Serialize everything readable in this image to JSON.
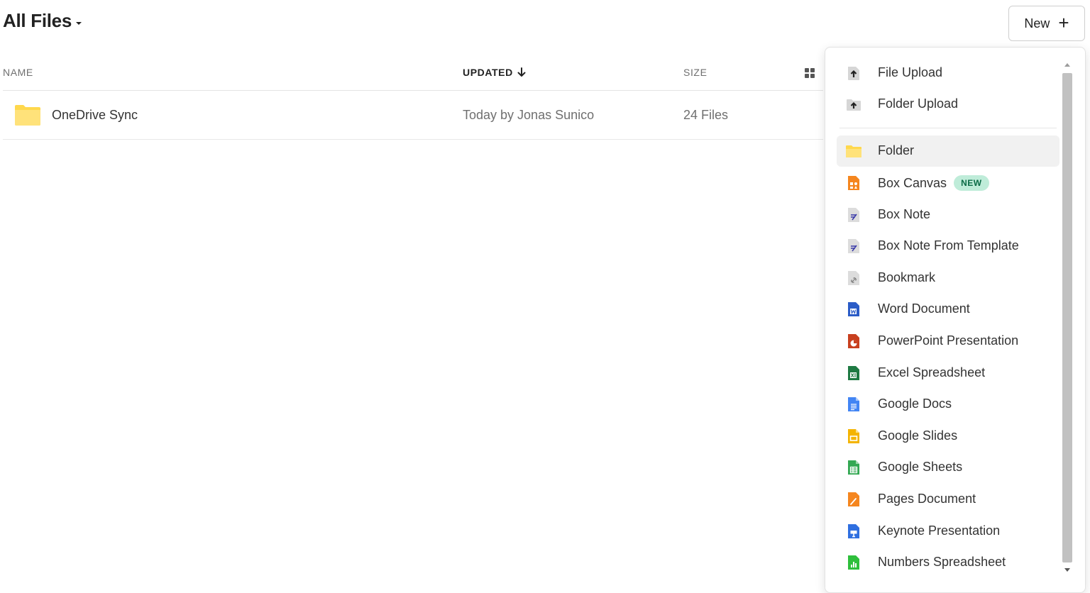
{
  "header": {
    "title": "All Files",
    "new_button_label": "New",
    "new_button_icon": "plus-icon"
  },
  "table": {
    "columns": {
      "name": "NAME",
      "updated": "UPDATED",
      "size": "SIZE"
    },
    "sort_icon": "arrow-down-icon",
    "view_icon": "grid-view-icon",
    "rows": [
      {
        "name": "OneDrive Sync",
        "updated": "Today by Jonas Sunico",
        "size": "24 Files",
        "icon": "folder-icon"
      }
    ]
  },
  "menu": {
    "items": [
      {
        "label": "File Upload",
        "icon": "file-upload-icon"
      },
      {
        "label": "Folder Upload",
        "icon": "folder-upload-icon"
      },
      {
        "label": "Folder",
        "icon": "folder-icon"
      },
      {
        "label": "Box Canvas",
        "icon": "box-canvas-icon",
        "badge": "NEW"
      },
      {
        "label": "Box Note",
        "icon": "box-note-icon"
      },
      {
        "label": "Box Note From Template",
        "icon": "box-note-template-icon"
      },
      {
        "label": "Bookmark",
        "icon": "bookmark-icon"
      },
      {
        "label": "Word Document",
        "icon": "word-icon"
      },
      {
        "label": "PowerPoint Presentation",
        "icon": "powerpoint-icon"
      },
      {
        "label": "Excel Spreadsheet",
        "icon": "excel-icon"
      },
      {
        "label": "Google Docs",
        "icon": "google-docs-icon"
      },
      {
        "label": "Google Slides",
        "icon": "google-slides-icon"
      },
      {
        "label": "Google Sheets",
        "icon": "google-sheets-icon"
      },
      {
        "label": "Pages Document",
        "icon": "pages-icon"
      },
      {
        "label": "Keynote Presentation",
        "icon": "keynote-icon"
      },
      {
        "label": "Numbers Spreadsheet",
        "icon": "numbers-icon"
      }
    ]
  },
  "colors": {
    "folder": "#ffd84d",
    "badge_bg": "#bfecd9",
    "badge_text": "#0b6b46",
    "word": "#2b5cc7",
    "powerpoint": "#c8401f",
    "excel": "#1f7a43",
    "google_docs": "#4285f4",
    "google_slides": "#f4b400",
    "google_sheets": "#34a853",
    "pages": "#f5861f",
    "keynote": "#2f6fe0",
    "numbers": "#2fbf3c",
    "box_canvas": "#f5861f"
  }
}
